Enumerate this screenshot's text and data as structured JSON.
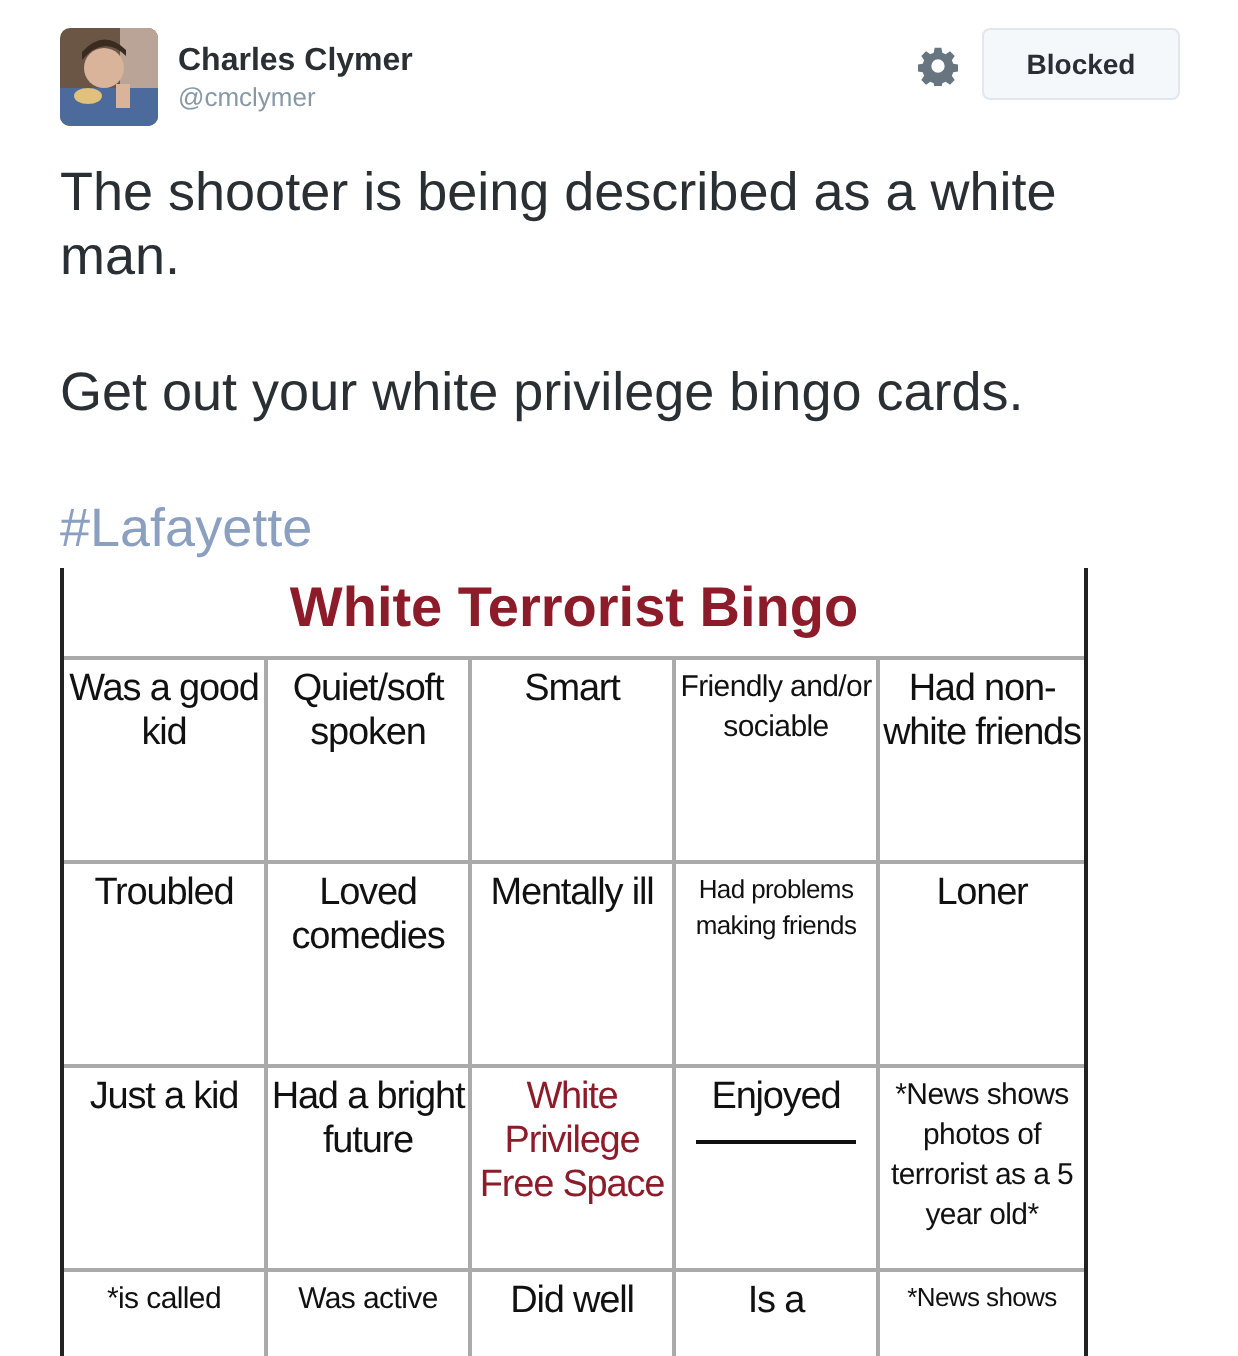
{
  "author": {
    "name": "Charles Clymer",
    "handle": "@cmclymer"
  },
  "follow_button": {
    "label": "Blocked"
  },
  "tweet": {
    "paragraphs": [
      "The shooter is being described as a white man.",
      "Get out your white privilege bingo cards."
    ],
    "hashtag": "#Lafayette"
  },
  "bingo_card": {
    "title": "White Terrorist Bingo",
    "rows": [
      [
        {
          "kind": "text",
          "text": "Was a good kid"
        },
        {
          "kind": "text",
          "text": "Quiet/soft spoken"
        },
        {
          "kind": "text",
          "text": "Smart"
        },
        {
          "kind": "medium",
          "text": "Friendly and/or sociable"
        },
        {
          "kind": "text",
          "text": "Had non-white friends"
        }
      ],
      [
        {
          "kind": "text",
          "text": "Troubled"
        },
        {
          "kind": "text",
          "text": "Loved comedies"
        },
        {
          "kind": "text",
          "text": "Mentally ill"
        },
        {
          "kind": "small",
          "text": "Had problems making friends"
        },
        {
          "kind": "text",
          "text": "Loner"
        }
      ],
      [
        {
          "kind": "text",
          "text": "Just a kid"
        },
        {
          "kind": "text",
          "text": "Had a bright future"
        },
        {
          "kind": "free",
          "text": "White Privilege Free Space"
        },
        {
          "kind": "fill_in",
          "text": "Enjoyed"
        },
        {
          "kind": "medium",
          "text": "*News shows photos of terrorist as a 5 year old*"
        }
      ],
      [
        {
          "kind": "medium",
          "text": "*is called"
        },
        {
          "kind": "medium",
          "text": "Was active"
        },
        {
          "kind": "text",
          "text": "Did well"
        },
        {
          "kind": "text",
          "text": "Is a"
        },
        {
          "kind": "small",
          "text": "*News shows"
        }
      ]
    ]
  }
}
